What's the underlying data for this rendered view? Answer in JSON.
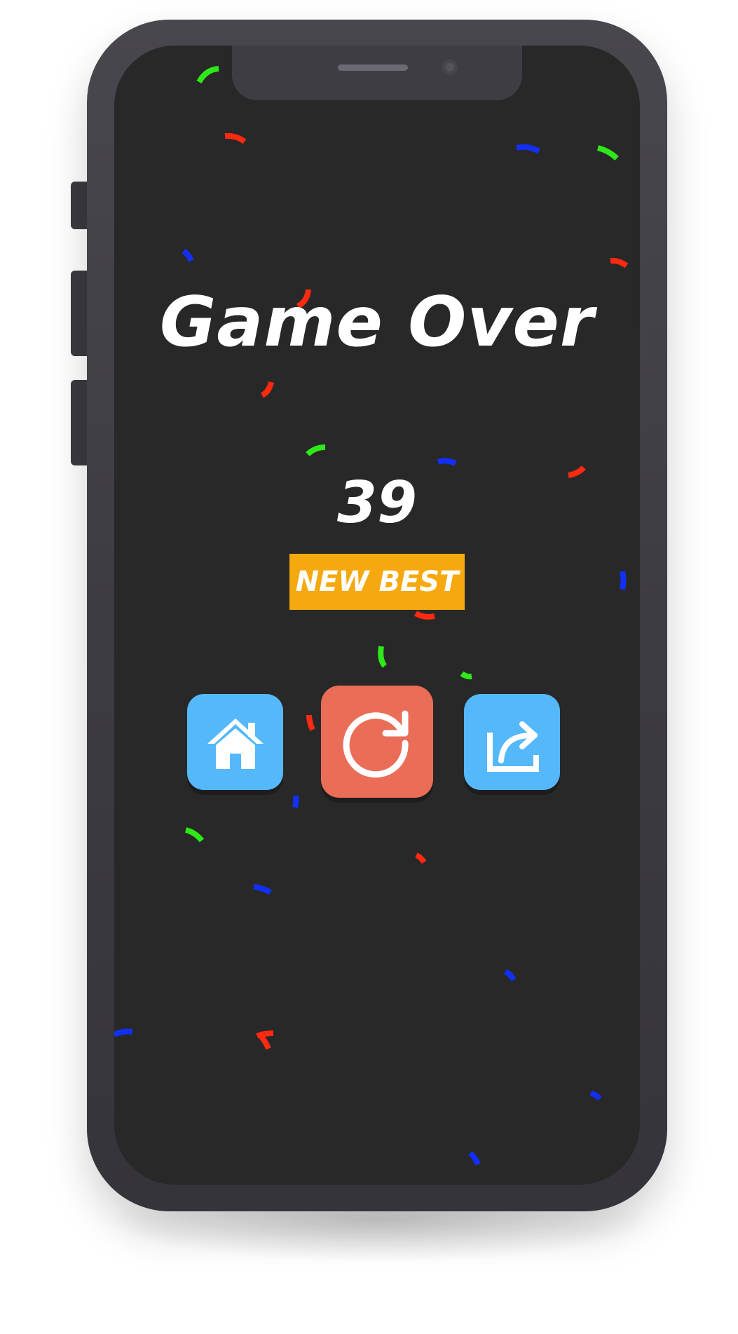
{
  "screen": {
    "title": "Game Over",
    "score": "39",
    "badge": "NEW BEST"
  },
  "buttons": {
    "home": {
      "icon": "home-icon"
    },
    "restart": {
      "icon": "restart-icon"
    },
    "share": {
      "icon": "share-icon"
    }
  },
  "colors": {
    "background": "#282828",
    "badge": "#f6a90e",
    "home_button": "#55b8fb",
    "restart_button": "#ea6d57",
    "share_button": "#55b8fb",
    "confetti": [
      "#ff2a10",
      "#2ee81a",
      "#1230f5"
    ]
  }
}
